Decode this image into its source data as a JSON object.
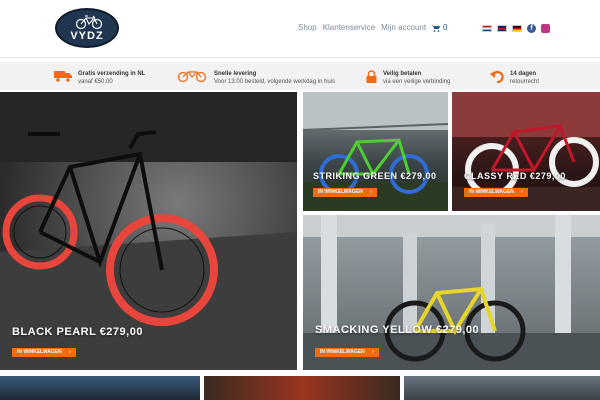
{
  "header": {
    "logo_text": "VYDZ",
    "nav": [
      "Shop",
      "Klantenservice",
      "Mijn account"
    ],
    "cart_count": "0"
  },
  "usps": [
    {
      "title": "Gratis verzending in NL",
      "sub": "vanaf €50,00",
      "icon": "truck-icon"
    },
    {
      "title": "Snelle levering",
      "sub": "Voor 13:00 besteld, volgende werkdag in huis",
      "icon": "bike-icon"
    },
    {
      "title": "Veilig betalen",
      "sub": "via een veilige verbinding",
      "icon": "lock-icon"
    },
    {
      "title": "14 dagen",
      "sub": "retourrecht",
      "icon": "return-arrow-icon"
    }
  ],
  "tiles": [
    {
      "title": "BLACK PEARL €279,00",
      "button": "IN WINKELWAGEN",
      "wheel_color": "#e8453c"
    },
    {
      "title": "STRIKING GREEN €279,00",
      "button": "IN WINKELWAGEN",
      "wheel_color": "#2f6cd6"
    },
    {
      "title": "CLASSY RED €279,00",
      "button": "IN WINKELWAGEN",
      "wheel_color": "#f1f1f1"
    },
    {
      "title": "SMACKING YELLOW €279,00",
      "button": "IN WINKELWAGEN",
      "wheel_color": "#1a1a1a"
    }
  ],
  "colors": {
    "accent": "#f06b12",
    "logo_bg": "#1f3550",
    "nav_text": "#7b8a99"
  }
}
